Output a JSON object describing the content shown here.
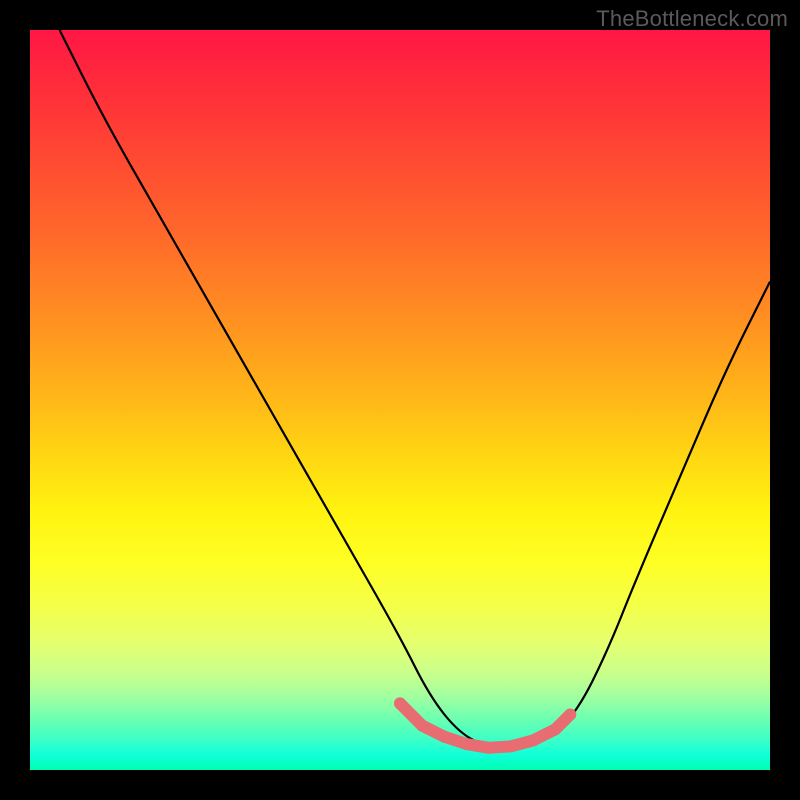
{
  "watermark": "TheBottleneck.com",
  "chart_data": {
    "type": "line",
    "title": "",
    "xlabel": "",
    "ylabel": "",
    "xlim": [
      0,
      100
    ],
    "ylim": [
      0,
      100
    ],
    "background_gradient": {
      "top": "#ff1744",
      "mid": "#ffd812",
      "bottom": "#00ffb4"
    },
    "series": [
      {
        "name": "bottleneck-curve",
        "color": "#000000",
        "x": [
          4,
          10,
          18,
          26,
          34,
          42,
          50,
          54,
          58,
          62,
          66,
          70,
          74,
          78,
          82,
          88,
          94,
          100
        ],
        "y": [
          100,
          88,
          74,
          60,
          46,
          32,
          18,
          10,
          5,
          3,
          3,
          4,
          8,
          16,
          26,
          40,
          54,
          66
        ]
      }
    ],
    "markers": {
      "name": "valley-markers",
      "color": "#e86d72",
      "radius_px": 6,
      "points": [
        {
          "x": 50,
          "y": 9
        },
        {
          "x": 53,
          "y": 6
        },
        {
          "x": 56,
          "y": 4.5
        },
        {
          "x": 59,
          "y": 3.5
        },
        {
          "x": 62,
          "y": 3
        },
        {
          "x": 65,
          "y": 3.2
        },
        {
          "x": 68,
          "y": 4
        },
        {
          "x": 71,
          "y": 5.5
        },
        {
          "x": 73,
          "y": 7.5
        }
      ]
    }
  }
}
